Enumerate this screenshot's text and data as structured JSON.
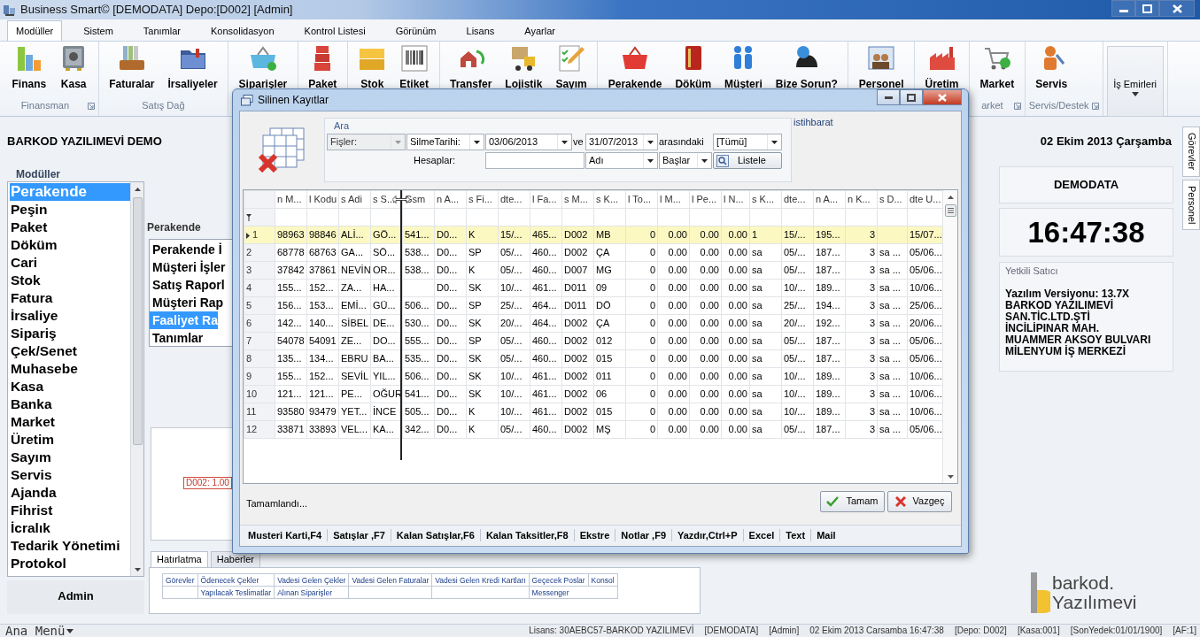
{
  "window": {
    "title": "Business Smart© [DEMODATA] Depo:[D002] [Admin]"
  },
  "ribbon_tabs": [
    {
      "label": "Modüller",
      "selected": true
    },
    {
      "label": "Sistem",
      "selected": false
    },
    {
      "label": "Tanımlar",
      "selected": false
    },
    {
      "label": "Konsolidasyon",
      "selected": false
    },
    {
      "label": "Kontrol Listesi",
      "selected": false
    },
    {
      "label": "Görünüm",
      "selected": false
    },
    {
      "label": "Lisans",
      "selected": false
    },
    {
      "label": "Ayarlar",
      "selected": false
    }
  ],
  "ribbon_groups": [
    {
      "label": "Finansman",
      "launcher": true,
      "buttons": [
        {
          "label": "Finans",
          "kind": "large"
        },
        {
          "label": "Kasa",
          "kind": "large"
        }
      ]
    },
    {
      "label": "Satış Dağ",
      "launcher": false,
      "buttons": [
        {
          "label": "Faturalar",
          "kind": "large"
        },
        {
          "label": "İrsaliyeler",
          "kind": "large"
        }
      ]
    },
    {
      "launcher": false,
      "buttons": [
        {
          "label": "Siparişler",
          "kind": "large"
        }
      ]
    },
    {
      "launcher": false,
      "buttons": [
        {
          "label": "Paket",
          "kind": "large"
        }
      ]
    },
    {
      "launcher": false,
      "buttons": [
        {
          "label": "Stok",
          "kind": "large"
        },
        {
          "label": "Etiket",
          "kind": "large"
        }
      ]
    },
    {
      "launcher": false,
      "buttons": [
        {
          "label": "Transfer",
          "kind": "large"
        },
        {
          "label": "Lojistik",
          "kind": "large"
        },
        {
          "label": "Sayım",
          "kind": "large"
        }
      ]
    },
    {
      "launcher": false,
      "buttons": [
        {
          "label": "Perakende",
          "kind": "large"
        },
        {
          "label": "Döküm",
          "kind": "large"
        },
        {
          "label": "Müşteri",
          "kind": "large"
        },
        {
          "label": "Bize Sorun?",
          "kind": "large"
        }
      ]
    },
    {
      "launcher": false,
      "buttons": [
        {
          "label": "Personel",
          "kind": "large"
        }
      ]
    },
    {
      "launcher": false,
      "buttons": [
        {
          "label": "Üretim",
          "kind": "large"
        }
      ]
    },
    {
      "label": "arket",
      "launcher": true,
      "buttons": [
        {
          "label": "Market",
          "kind": "large"
        }
      ]
    },
    {
      "label": "Servis/Destek",
      "launcher": true,
      "buttons": [
        {
          "label": "Servis",
          "kind": "large"
        }
      ]
    },
    {
      "launcher": false,
      "buttons": [
        {
          "label": "İş Emirleri",
          "kind": "dropdown"
        }
      ]
    }
  ],
  "header": {
    "company": "BARKOD YAZILIMEVİ DEMO",
    "date": "02 Ekim 2013 Çarşamba"
  },
  "sidebar": {
    "title": "Modüller",
    "items": [
      {
        "label": "Perakende",
        "selected": true
      },
      {
        "label": "Peşin",
        "selected": false
      },
      {
        "label": "Paket",
        "selected": false
      },
      {
        "label": "Döküm",
        "selected": false
      },
      {
        "label": "Cari",
        "selected": false
      },
      {
        "label": "Stok",
        "selected": false
      },
      {
        "label": "Fatura",
        "selected": false
      },
      {
        "label": "İrsaliye",
        "selected": false
      },
      {
        "label": "Sipariş",
        "selected": false
      },
      {
        "label": "Çek/Senet",
        "selected": false
      },
      {
        "label": "Muhasebe",
        "selected": false
      },
      {
        "label": "Kasa",
        "selected": false
      },
      {
        "label": "Banka",
        "selected": false
      },
      {
        "label": "Market",
        "selected": false
      },
      {
        "label": "Üretim",
        "selected": false
      },
      {
        "label": "Sayım",
        "selected": false
      },
      {
        "label": "Servis",
        "selected": false
      },
      {
        "label": "Ajanda",
        "selected": false
      },
      {
        "label": "Fihrist",
        "selected": false
      },
      {
        "label": "İcralık",
        "selected": false
      },
      {
        "label": "Tedarik Yönetimi",
        "selected": false
      },
      {
        "label": "Protokol",
        "selected": false
      }
    ],
    "user": "Admin"
  },
  "module_menu": {
    "title": "Perakende",
    "items": [
      {
        "label": "Perakende İ",
        "selected": false
      },
      {
        "label": "Müşteri İşler",
        "selected": false
      },
      {
        "label": "Satış Raporl",
        "selected": false
      },
      {
        "label": "Müşteri Rap",
        "selected": false
      },
      {
        "label": "Faaliyet Ra",
        "selected": true
      },
      {
        "label": "Tanımlar",
        "selected": false
      }
    ]
  },
  "chart_panel": {
    "tag": "D002: 1.00"
  },
  "reminders": {
    "tabs": [
      {
        "label": "Hatırlatma",
        "selected": true
      },
      {
        "label": "Haberler",
        "selected": false
      }
    ],
    "rows": [
      [
        "Görevler",
        "Ödenecek Çekler",
        "Vadesi Gelen Çekler",
        "Vadesi Gelen Faturalar",
        "Vadesi Gelen Kredi Kartları",
        "Geçecek Poslar",
        "Konsol"
      ],
      [
        null,
        "Yapılacak Teslimatlar",
        "Alınan Siparişler",
        null,
        null,
        {
          "text": "Messenger",
          "colspan": 2
        }
      ]
    ]
  },
  "right_panel": {
    "database": "DEMODATA",
    "time": "16:47:38",
    "dealer": {
      "title": "Yetkili Satıcı",
      "version": "Yazılım Versiyonu: 13.7X",
      "address": "BARKOD YAZILIMEVİ SAN.TİC.LTD.ŞTİ İNCİLİPINAR MAH. MUAMMER AKSOY BULVARI MİLENYUM İŞ MERKEZİ"
    },
    "logo": {
      "name": "barkod.",
      "sub": "Yazılımevi"
    }
  },
  "side_tabs": [
    "Görevler",
    "Personel"
  ],
  "dialog": {
    "title": "Silinen Kayıtlar",
    "filter": {
      "group_label": "Ara",
      "side_label": "istihbarat",
      "row1": [
        {
          "kind": "combo",
          "value": "Fişler:",
          "disabled": true
        },
        {
          "kind": "combo",
          "value": "SilmeTarihi:",
          "disabled": false
        },
        {
          "kind": "combo",
          "value": "03/06/2013",
          "disabled": false
        },
        {
          "kind": "label",
          "text": "ve"
        },
        {
          "kind": "combo",
          "value": "31/07/2013",
          "disabled": false
        },
        {
          "kind": "label",
          "text": "arasındaki"
        },
        {
          "kind": "combo",
          "value": "[Tümü]",
          "disabled": false
        }
      ],
      "row2": [
        {
          "kind": "label",
          "text": "Hesaplar:"
        },
        {
          "kind": "input"
        },
        {
          "kind": "combo",
          "value": "Adı",
          "disabled": false
        },
        {
          "kind": "combo",
          "value": "Başlar",
          "disabled": false
        },
        {
          "kind": "button",
          "text": "Listele"
        }
      ]
    },
    "table": {
      "columns": [
        "n M...",
        "l Kodu",
        "s Adi",
        "s S...",
        "Gsm",
        "n A...",
        "s Fi...",
        "dte...",
        "l Fa...",
        "s M...",
        "s K...",
        "l To...",
        "l M...",
        "l Pe...",
        "l N...",
        "s K...",
        "dte...",
        "n A...",
        "n K...",
        "s D...",
        "dte U..."
      ],
      "rows": [
        {
          "num": "1",
          "selected": true,
          "cells": [
            "98963",
            "98846",
            "ALİ...",
            "GÖ...",
            "541...",
            "D0...",
            "K",
            "15/...",
            "465...",
            "D002",
            "MB",
            "0",
            "0.00",
            "0.00",
            "0.00",
            "1",
            "15/...",
            "195...",
            "3",
            null,
            "15/07..."
          ]
        },
        {
          "num": "2",
          "selected": false,
          "cells": [
            "68778",
            "68763",
            "GA...",
            "SÖ...",
            "538...",
            "D0...",
            "SP",
            "05/...",
            "460...",
            "D002",
            "ÇA",
            "0",
            "0.00",
            "0.00",
            "0.00",
            "sa",
            "05/...",
            "187...",
            "3",
            "sa ...",
            "05/06..."
          ]
        },
        {
          "num": "3",
          "selected": false,
          "cells": [
            "37842",
            "37861",
            "NEVİN",
            "OR...",
            "538...",
            "D0...",
            "K",
            "05/...",
            "460...",
            "D007",
            "MG",
            "0",
            "0.00",
            "0.00",
            "0.00",
            "sa",
            "05/...",
            "187...",
            "3",
            "sa ...",
            "05/06..."
          ]
        },
        {
          "num": "4",
          "selected": false,
          "cells": [
            "155...",
            "152...",
            "ZA...",
            "HA...",
            null,
            "D0...",
            "SK",
            "10/...",
            "461...",
            "D011",
            "09",
            "0",
            "0.00",
            "0.00",
            "0.00",
            "sa",
            "10/...",
            "189...",
            "3",
            "sa ...",
            "10/06..."
          ]
        },
        {
          "num": "5",
          "selected": false,
          "cells": [
            "156...",
            "153...",
            "EMİ...",
            "GÜ...",
            "506...",
            "D0...",
            "SP",
            "25/...",
            "464...",
            "D011",
            "DÖ",
            "0",
            "0.00",
            "0.00",
            "0.00",
            "sa",
            "25/...",
            "194...",
            "3",
            "sa ...",
            "25/06..."
          ]
        },
        {
          "num": "6",
          "selected": false,
          "cells": [
            "142...",
            "140...",
            "SİBEL",
            "DE...",
            "530...",
            "D0...",
            "SK",
            "20/...",
            "464...",
            "D002",
            "ÇA",
            "0",
            "0.00",
            "0.00",
            "0.00",
            "sa",
            "20/...",
            "192...",
            "3",
            "sa ...",
            "20/06..."
          ]
        },
        {
          "num": "7",
          "selected": false,
          "cells": [
            "54078",
            "54091",
            "ZE...",
            "DO...",
            "555...",
            "D0...",
            "SP",
            "05/...",
            "460...",
            "D002",
            "012",
            "0",
            "0.00",
            "0.00",
            "0.00",
            "sa",
            "05/...",
            "187...",
            "3",
            "sa ...",
            "05/06..."
          ]
        },
        {
          "num": "8",
          "selected": false,
          "cells": [
            "135...",
            "134...",
            "EBRU",
            "BA...",
            "535...",
            "D0...",
            "SK",
            "05/...",
            "460...",
            "D002",
            "015",
            "0",
            "0.00",
            "0.00",
            "0.00",
            "sa",
            "05/...",
            "187...",
            "3",
            "sa ...",
            "05/06..."
          ]
        },
        {
          "num": "9",
          "selected": false,
          "cells": [
            "155...",
            "152...",
            "SEVİL",
            "YIL...",
            "506...",
            "D0...",
            "SK",
            "10/...",
            "461...",
            "D002",
            "011",
            "0",
            "0.00",
            "0.00",
            "0.00",
            "sa",
            "10/...",
            "189...",
            "3",
            "sa ...",
            "10/06..."
          ]
        },
        {
          "num": "10",
          "selected": false,
          "cells": [
            "121...",
            "121...",
            "PE...",
            "OĞUR",
            "541...",
            "D0...",
            "SK",
            "10/...",
            "461...",
            "D002",
            "06",
            "0",
            "0.00",
            "0.00",
            "0.00",
            "sa",
            "10/...",
            "189...",
            "3",
            "sa ...",
            "10/06..."
          ]
        },
        {
          "num": "11",
          "selected": false,
          "cells": [
            "93580",
            "93479",
            "YET...",
            "İNCE",
            "505...",
            "D0...",
            "K",
            "10/...",
            "461...",
            "D002",
            "015",
            "0",
            "0.00",
            "0.00",
            "0.00",
            "sa",
            "10/...",
            "189...",
            "3",
            "sa ...",
            "10/06..."
          ]
        },
        {
          "num": "12",
          "selected": false,
          "cells": [
            "33871",
            "33893",
            "VEL...",
            "KA...",
            "342...",
            "D0...",
            "K",
            "05/...",
            "460...",
            "D002",
            "MŞ",
            "0",
            "0.00",
            "0.00",
            "0.00",
            "sa",
            "05/...",
            "187...",
            "3",
            "sa ...",
            "05/06..."
          ]
        }
      ]
    },
    "status": "Tamamlandı...",
    "buttons": [
      {
        "label": "Tamam",
        "kind": "ok"
      },
      {
        "label": "Vazgeç",
        "kind": "cancel"
      }
    ],
    "toolbar": [
      "Musteri Karti,F4",
      "Satışlar ,F7",
      "Kalan Satışlar,F6",
      "Kalan Taksitler,F8",
      "Ekstre",
      "Notlar ,F9",
      "Yazdır,Ctrl+P",
      "Excel",
      "Text",
      "Mail"
    ]
  },
  "status_bar": {
    "menu": "Ana Menü",
    "items": [
      "Lisans: 30AEBC57-BARKOD YAZILIMEVİ",
      "[DEMODATA]",
      "[Admin]",
      "02 Ekim 2013 Carsamba 16:47:38",
      "[Depo: D002]",
      "[Kasa:001]",
      "[SonYedek:01/01/1900]",
      "[AF:1]"
    ]
  }
}
